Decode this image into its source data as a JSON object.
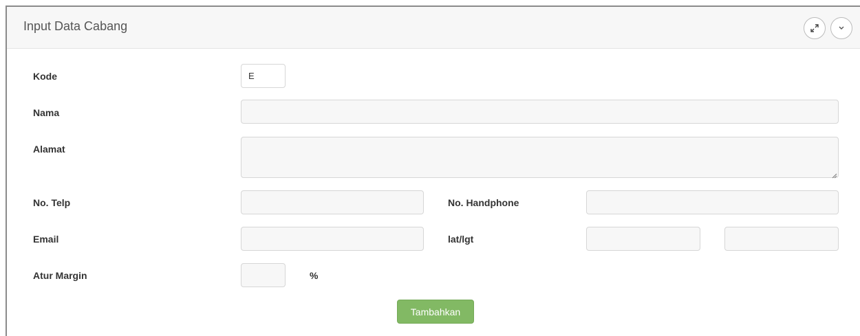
{
  "panel": {
    "title": "Input Data Cabang",
    "expand_icon": "expand-icon",
    "collapse_icon": "chevron-down-icon"
  },
  "form": {
    "kode": {
      "label": "Kode",
      "value": "E"
    },
    "nama": {
      "label": "Nama",
      "value": ""
    },
    "alamat": {
      "label": "Alamat",
      "value": ""
    },
    "telp": {
      "label": "No. Telp",
      "value": ""
    },
    "handphone": {
      "label": "No. Handphone",
      "value": ""
    },
    "email": {
      "label": "Email",
      "value": ""
    },
    "latlgt": {
      "label": "lat/lgt",
      "lat_value": "",
      "lgt_value": ""
    },
    "margin": {
      "label": "Atur Margin",
      "value": "",
      "unit": "%"
    },
    "submit_label": "Tambahkan"
  },
  "colors": {
    "submit_button": "#82b964",
    "header_bg": "#f7f7f7",
    "input_bg": "#f7f7f7"
  }
}
